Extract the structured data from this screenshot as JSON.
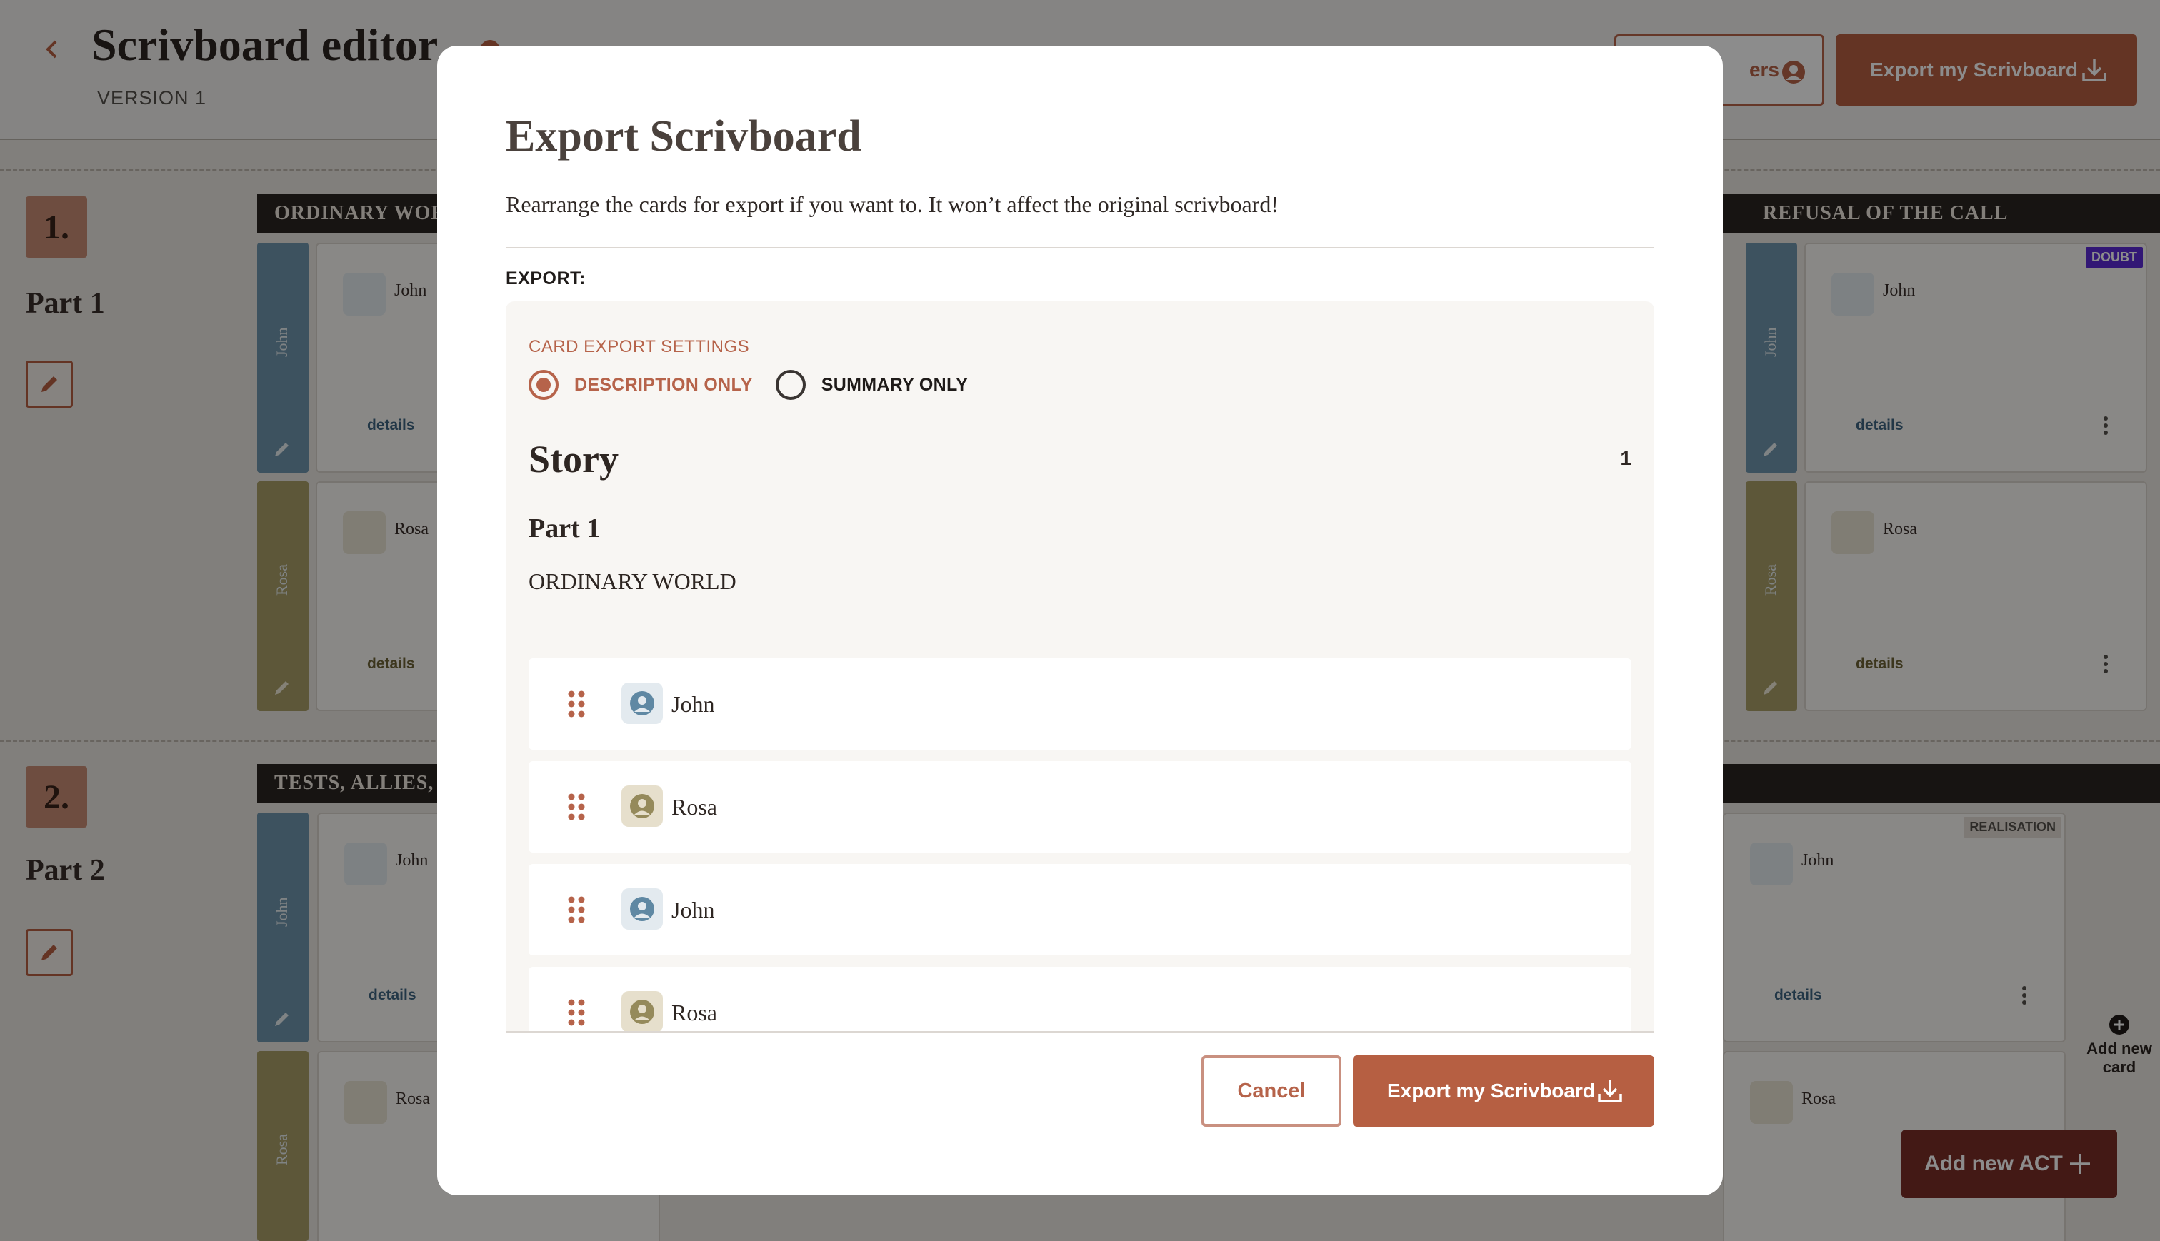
{
  "app": {
    "title": "Scrivboard editor",
    "version": "VERSION 1",
    "share_button_partial": "ers",
    "export_button": "Export my Scrivboard"
  },
  "acts": [
    {
      "number": "1.",
      "name": "Part 1",
      "columns": [
        {
          "heading": "ORDINARY WORLD"
        },
        {
          "heading": "REFUSAL OF THE CALL",
          "tag": "DOUBT"
        }
      ]
    },
    {
      "number": "2.",
      "name": "Part 2",
      "columns": [
        {
          "heading": "TESTS, ALLIES, &"
        },
        {
          "tag": "REALISATION"
        }
      ]
    }
  ],
  "board": {
    "lanes": {
      "john": "John",
      "rosa": "Rosa"
    },
    "card_details": "details",
    "add_card": "Add new card",
    "add_act": "Add new ACT"
  },
  "modal": {
    "title": "Export Scrivboard",
    "description": "Rearrange the cards for export if you want to. It won’t affect the original scrivboard!",
    "export_label": "EXPORT:",
    "settings_label": "CARD EXPORT SETTINGS",
    "options": [
      {
        "label": "DESCRIPTION ONLY",
        "selected": true
      },
      {
        "label": "SUMMARY ONLY",
        "selected": false
      }
    ],
    "story_heading": "Story",
    "story_count": "1",
    "part_heading": "Part 1",
    "stage_heading": "ORDINARY WORLD",
    "rows": [
      {
        "name": "John",
        "type": "john"
      },
      {
        "name": "Rosa",
        "type": "rosa"
      },
      {
        "name": "John",
        "type": "john"
      },
      {
        "name": "Rosa",
        "type": "rosa"
      }
    ],
    "cancel_button": "Cancel",
    "export_button": "Export my Scrivboard"
  },
  "colors": {
    "accent": "#b65f42",
    "john_lane": "#6f95ad",
    "rosa_lane": "#a99f68",
    "add_act": "#7a2e27",
    "tag_doubt": "#5b2ad6"
  }
}
